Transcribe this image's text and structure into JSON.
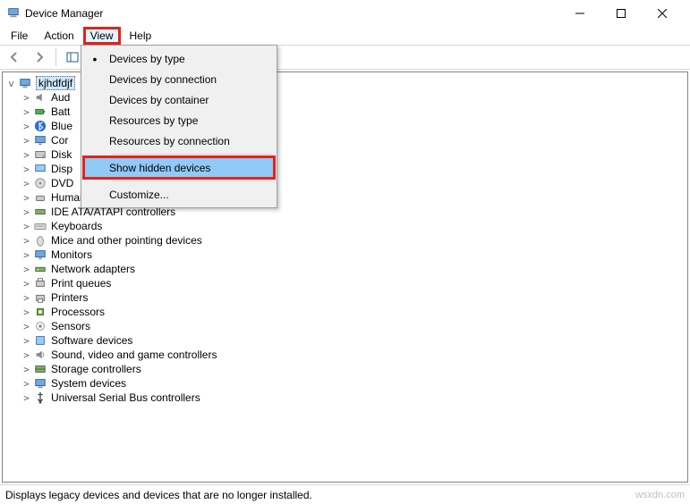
{
  "window": {
    "title": "Device Manager"
  },
  "menubar": {
    "file": "File",
    "action": "Action",
    "view": "View",
    "help": "Help"
  },
  "dropdown": {
    "devices_by_type": "Devices by type",
    "devices_by_connection": "Devices by connection",
    "devices_by_container": "Devices by container",
    "resources_by_type": "Resources by type",
    "resources_by_connection": "Resources by connection",
    "show_hidden_devices": "Show hidden devices",
    "customize": "Customize..."
  },
  "tree": {
    "root": "kjhdfdjf",
    "items": [
      "Aud",
      "Batt",
      "Blue",
      "Cor",
      "Disk",
      "Disp",
      "DVD",
      "Human Interface Devices",
      "IDE ATA/ATAPI controllers",
      "Keyboards",
      "Mice and other pointing devices",
      "Monitors",
      "Network adapters",
      "Print queues",
      "Printers",
      "Processors",
      "Sensors",
      "Software devices",
      "Sound, video and game controllers",
      "Storage controllers",
      "System devices",
      "Universal Serial Bus controllers"
    ]
  },
  "status": {
    "text": "Displays legacy devices and devices that are no longer installed."
  },
  "watermark": "wsxdn.com"
}
